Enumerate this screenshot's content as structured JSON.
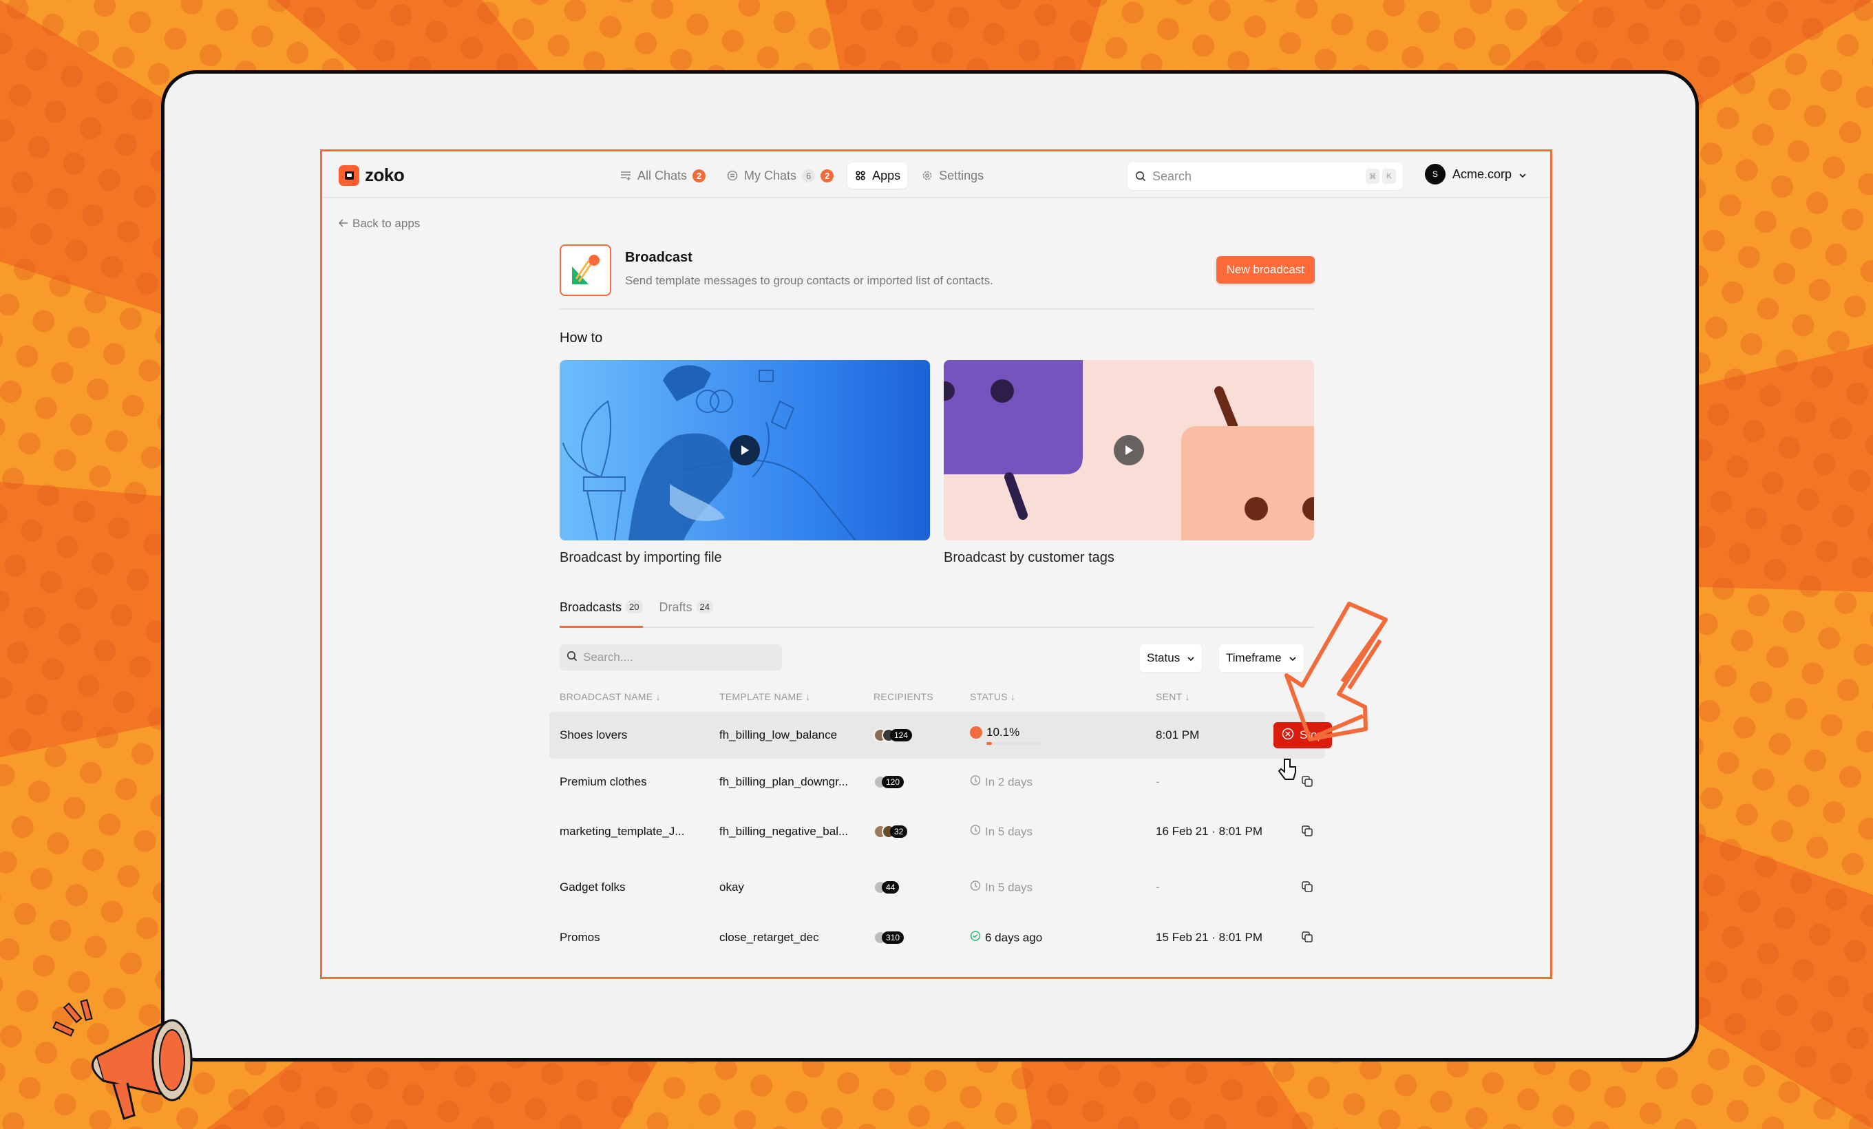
{
  "colors": {
    "accent": "#f26b3a",
    "stop": "#d91c0c",
    "success": "#2bb673",
    "frame_bg": "#f1f2f2"
  },
  "topbar": {
    "logo_text": "zoko",
    "nav": [
      {
        "label": "All Chats",
        "icon": "list-icon",
        "badge": "2"
      },
      {
        "label": "My Chats",
        "icon": "chat-icon",
        "count": "6",
        "badge": "2"
      },
      {
        "label": "Apps",
        "icon": "apps-icon",
        "active": true
      },
      {
        "label": "Settings",
        "icon": "gear-icon"
      }
    ],
    "search_placeholder": "Search",
    "shortcut_keys": [
      "⌘",
      "K"
    ],
    "account_initial": "S",
    "account_name": "Acme.corp"
  },
  "back_link": "Back to apps",
  "app": {
    "title": "Broadcast",
    "description": "Send template messages to group contacts or imported list of contacts.",
    "new_button": "New broadcast"
  },
  "howto": {
    "title": "How to",
    "videos": [
      {
        "caption": "Broadcast by importing file"
      },
      {
        "caption": "Broadcast by customer tags"
      }
    ]
  },
  "tabs": [
    {
      "label": "Broadcasts",
      "count": "20",
      "active": true
    },
    {
      "label": "Drafts",
      "count": "24"
    }
  ],
  "table": {
    "search_placeholder": "Search....",
    "filters": [
      "Status",
      "Timeframe"
    ],
    "columns": [
      "BROADCAST NAME ↓",
      "TEMPLATE NAME ↓",
      "RECIPIENTS",
      "STATUS ↓",
      "SENT ↓"
    ],
    "rows": [
      {
        "name": "Shoes lovers",
        "template": "fh_billing_low_balance",
        "recipients": "124",
        "status": "10.1%",
        "status_type": "sending",
        "progress": 0.101,
        "sent": "8:01 PM",
        "action": "Stop"
      },
      {
        "name": "Premium clothes",
        "template": "fh_billing_plan_downgr...",
        "recipients": "120",
        "status": "In 2 days",
        "status_type": "scheduled",
        "sent": "-",
        "action": "copy"
      },
      {
        "name": "marketing_template_J...",
        "template": "fh_billing_negative_bal...",
        "recipients": "32",
        "status": "In 5 days",
        "status_type": "scheduled",
        "sent": "16 Feb 21 · 8:01 PM",
        "action": "copy"
      },
      {
        "name": "Gadget folks",
        "template": "okay",
        "recipients": "44",
        "status": "In 5 days",
        "status_type": "scheduled",
        "sent": "-",
        "action": "copy"
      },
      {
        "name": "Promos",
        "template": "close_retarget_dec",
        "recipients": "310",
        "status": "6 days ago",
        "status_type": "done",
        "sent": "15 Feb 21 · 8:01 PM",
        "action": "copy"
      }
    ]
  }
}
